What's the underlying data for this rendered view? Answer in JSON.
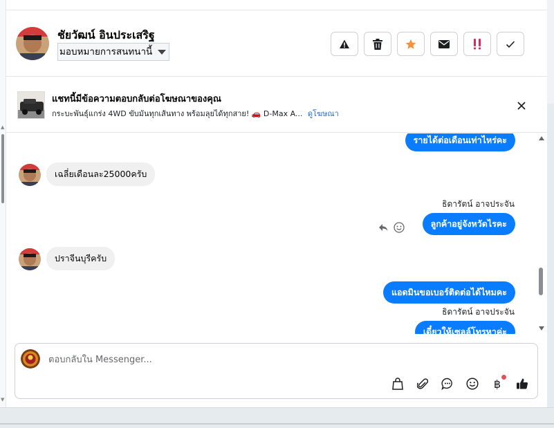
{
  "header": {
    "contact_name": "ชัยวัฒน์ อินประเสริฐ",
    "assign_label": "มอบหมายการสนทนานี้"
  },
  "actions": [
    {
      "name": "report-button",
      "icon": "warning-icon"
    },
    {
      "name": "delete-button",
      "icon": "trash-icon"
    },
    {
      "name": "star-button",
      "icon": "star-icon",
      "color": "#f7923a"
    },
    {
      "name": "mark-unread-button",
      "icon": "envelope-icon"
    },
    {
      "name": "mark-priority-button",
      "icon": "exclamation-icon",
      "color": "#e0245e"
    },
    {
      "name": "mark-done-button",
      "icon": "check-icon"
    }
  ],
  "ad": {
    "title": "แชทนี้มีข้อความตอบกลับต่อโฆษณาของคุณ",
    "description": "กระบะพันธุ์แกร่ง 4WD ขับมันทุกเส้นทาง พร้อมลุยได้ทุกสาย! 🚗 D-Max A...",
    "link": "ดูโฆษณา"
  },
  "messages": [
    {
      "dir": "out",
      "text": "รายได้ต่อเดือนเท่าไหร่คะ"
    },
    {
      "dir": "in",
      "text": "เฉลี่ยเดือนละ25000ครับ"
    },
    {
      "dir": "sender",
      "text": "ธิดารัตน์ อาจประจัน"
    },
    {
      "dir": "out",
      "text": "ลูกค้าอยู่จังหวัดไรคะ"
    },
    {
      "dir": "in",
      "text": "ปราจีนบุรีครับ"
    },
    {
      "dir": "out",
      "text": "แอดมินขอเบอร์ติดต่อได้ไหมคะ"
    },
    {
      "dir": "sender",
      "text": "ธิดารัตน์ อาจประจัน"
    },
    {
      "dir": "out",
      "text": "เดี๋ยวให้เซลล์โทรหาค่ะ"
    }
  ],
  "composer": {
    "placeholder": "ตอบกลับใน Messenger..."
  },
  "colors": {
    "accent": "#0a7cff",
    "link": "#216fdb"
  }
}
